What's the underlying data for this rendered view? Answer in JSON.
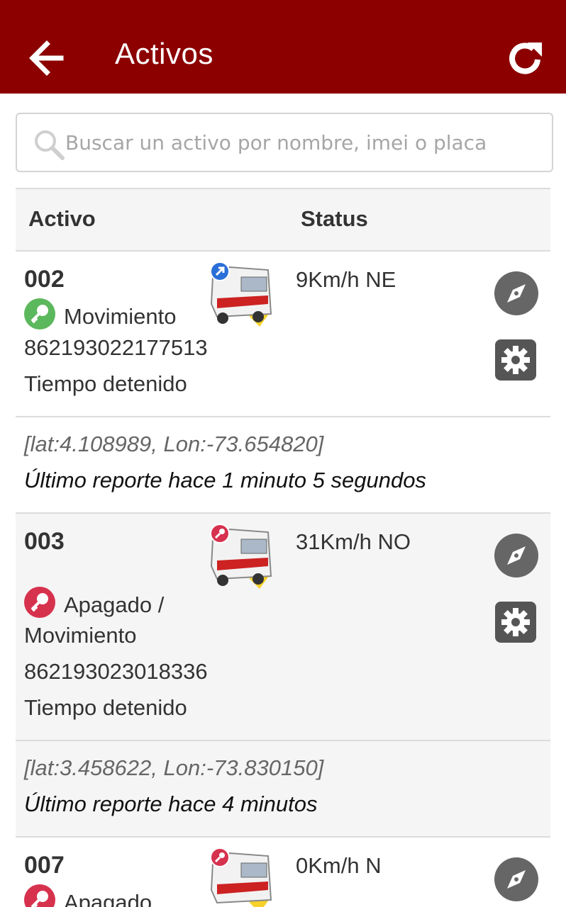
{
  "header": {
    "title": "Activos",
    "back_icon": "arrow-left-icon",
    "refresh_icon": "refresh-icon",
    "bg_color": "#8c0000"
  },
  "search": {
    "placeholder": "Buscar un activo por nombre, imei o placa",
    "value": "",
    "icon": "search-icon"
  },
  "table": {
    "headers": [
      "Activo",
      "Status"
    ]
  },
  "assets": [
    {
      "name": "002",
      "state": "Movimiento",
      "state_extra": "",
      "key_color": "#5cb85c",
      "imei": "862193022177513",
      "stop_label": "Tiempo detenido",
      "status": "9Km/h NE",
      "coords": "[lat:4.108989, Lon:-73.654820]",
      "report": "Último reporte hace 1 minuto 5 segundos"
    },
    {
      "name": "003",
      "state": "Apagado /",
      "state_extra": "Movimiento",
      "key_color": "#d6324e",
      "imei": "862193023018336",
      "stop_label": "Tiempo detenido",
      "status": "31Km/h NO",
      "coords": "[lat:3.458622, Lon:-73.830150]",
      "report": "Último reporte hace 4 minutos"
    },
    {
      "name": "007",
      "state": "Apagado",
      "state_extra": "",
      "key_color": "#d6324e",
      "status": "0Km/h N"
    }
  ]
}
